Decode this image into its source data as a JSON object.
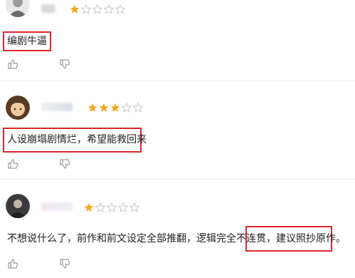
{
  "reviews": [
    {
      "text": "编剧牛逼",
      "rating": 1,
      "max": 5
    },
    {
      "text": "人设崩塌剧情烂，希望能救回来",
      "rating": 3,
      "max": 5
    },
    {
      "text_a": "不想说什么了，前作和前文设定全部推翻，逻辑完全不连贯，",
      "text_b": "建议照抄原作。",
      "rating": 1,
      "max": 5
    }
  ],
  "colors": {
    "star_on": "#f5a623",
    "star_off": "#c8c8c8",
    "highlight": "#d9282f"
  },
  "icons": {
    "like": "thumbs-up-icon",
    "dislike": "thumbs-down-icon"
  }
}
